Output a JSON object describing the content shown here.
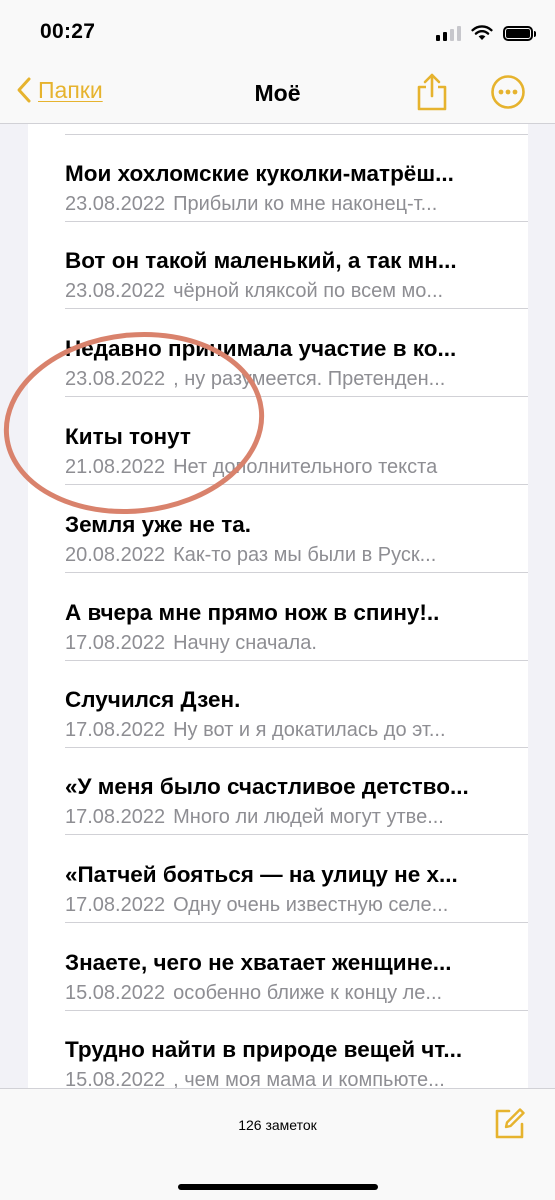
{
  "status_bar": {
    "time": "00:27",
    "icons": [
      "cellular-signal-icon",
      "wifi-icon",
      "battery-icon"
    ]
  },
  "nav": {
    "back_label": "Папки",
    "title": "Моё",
    "icons": [
      "chevron-left-icon",
      "share-icon",
      "more-icon"
    ]
  },
  "notes": [
    {
      "title": "Мои хохломские куколки-матрёш...",
      "date": "23.08.2022",
      "preview": "Прибыли ко мне наконец-т..."
    },
    {
      "title": "Вот он такой маленький, а так мн...",
      "date": "23.08.2022",
      "preview": "чёрной кляксой по всем мо..."
    },
    {
      "title": "Недавно принимала участие в ко...",
      "date": "23.08.2022",
      "preview": ", ну разумеется. Претенден..."
    },
    {
      "title": "Киты тонут",
      "date": "21.08.2022",
      "preview": "Нет дополнительного текста"
    },
    {
      "title": "Земля уже не та.",
      "date": "20.08.2022",
      "preview": "Как-то раз мы были в Руск..."
    },
    {
      "title": "А вчера мне прямо нож в спину!..",
      "date": "17.08.2022",
      "preview": "Начну сначала."
    },
    {
      "title": "Случился Дзен.",
      "date": "17.08.2022",
      "preview": "Ну вот и я докатилась до эт..."
    },
    {
      "title": "«У меня было счастливое детство...",
      "date": "17.08.2022",
      "preview": "Много ли людей могут утве..."
    },
    {
      "title": "«Патчей бояться — на улицу не х...",
      "date": "17.08.2022",
      "preview": "Одну очень известную селе..."
    },
    {
      "title": "Знаете, чего не хватает женщине...",
      "date": "15.08.2022",
      "preview": "особенно ближе к концу ле..."
    },
    {
      "title": "Трудно найти в природе вещей чт...",
      "date": "15.08.2022",
      "preview": ", чем моя мама и компьюте..."
    }
  ],
  "toolbar": {
    "notes_count": "126 заметок",
    "compose_icon": "compose-icon"
  },
  "colors": {
    "accent": "#e6b32e",
    "annotation": "#d9826c",
    "secondary_text": "#8e8e93",
    "background": "#f2f2f7"
  }
}
